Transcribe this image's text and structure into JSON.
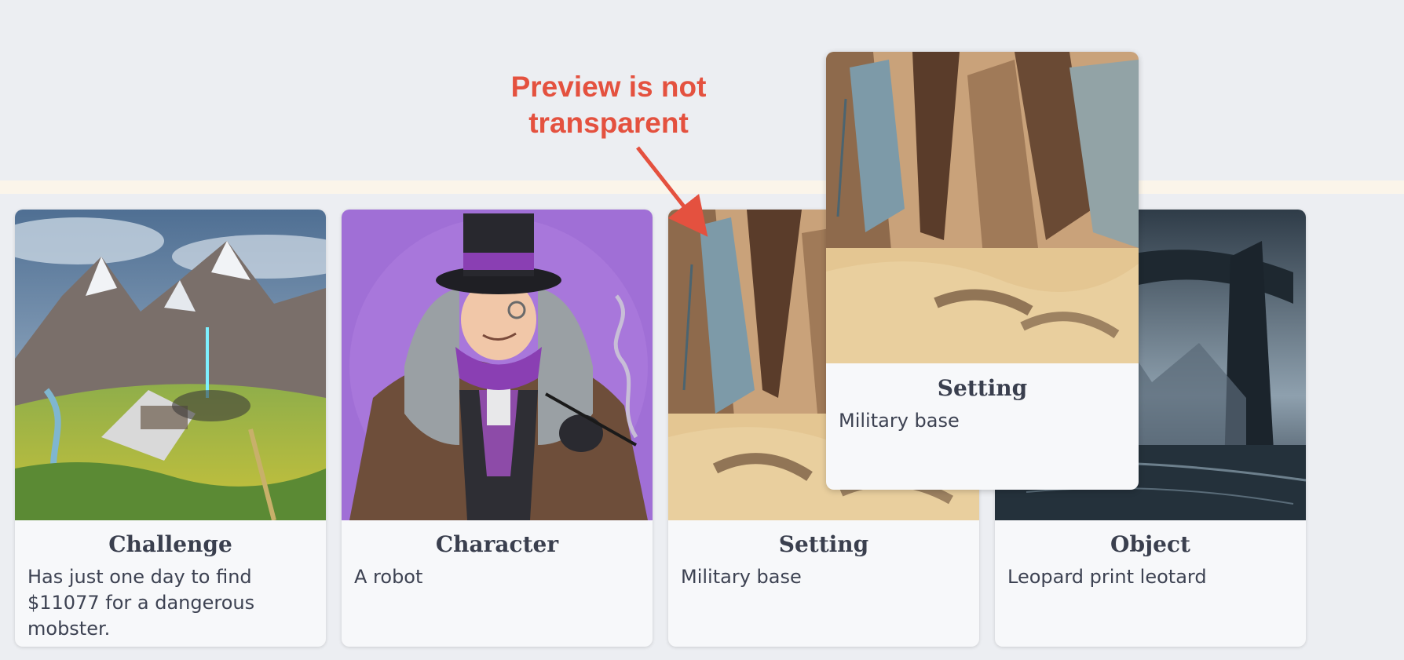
{
  "annotation": {
    "line1": "Preview is not",
    "line2": "transparent",
    "color": "#e4513f"
  },
  "cards": [
    {
      "title": "Challenge",
      "description": "Has just one day to find $11077 for a dangerous mobster.",
      "image": "mountain-valley-crash-illustration"
    },
    {
      "title": "Character",
      "description": "A robot",
      "image": "top-hat-gentleman-illustration"
    },
    {
      "title": "Setting",
      "description": "Military base",
      "image": "desert-ruins-illustration"
    },
    {
      "title": "Object",
      "description": "Leopard print leotard",
      "image": "dark-alien-landscape-illustration"
    }
  ],
  "preview": {
    "title": "Setting",
    "description": "Military base",
    "image": "desert-ruins-illustration"
  }
}
